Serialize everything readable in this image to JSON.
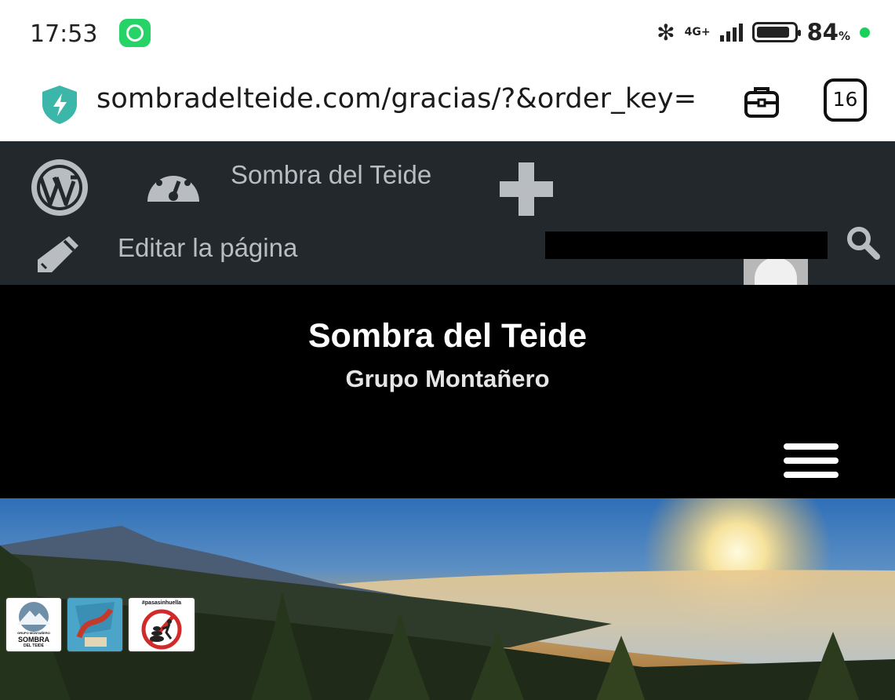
{
  "status": {
    "time": "17:53",
    "network": "4G+",
    "battery_percent": "84",
    "percent_sign": "%",
    "icons": [
      "whatsapp-icon",
      "bluetooth-icon",
      "signal-icon",
      "battery-icon"
    ]
  },
  "browser": {
    "url": "sombradelteide.com/gracias/?&order_key=",
    "tab_count": "16"
  },
  "admin_bar": {
    "site_name": "Sombra del Teide",
    "edit_page": "Editar la página",
    "icons": [
      "wordpress-logo-icon",
      "dashboard-icon",
      "plus-icon",
      "pencil-icon",
      "search-icon"
    ]
  },
  "site": {
    "title": "Sombra del Teide",
    "description": "Grupo Montañero"
  },
  "badges": {
    "logo_sub": "GRUPO MONTAÑERO",
    "logo_main": "SOMBRA",
    "logo_footer": "DEL TEIDE",
    "campaign_tag": "#pasasinhuella"
  },
  "colors": {
    "admin_bar": "#23282d",
    "header": "#000000",
    "shield": "#3bb6a8"
  }
}
